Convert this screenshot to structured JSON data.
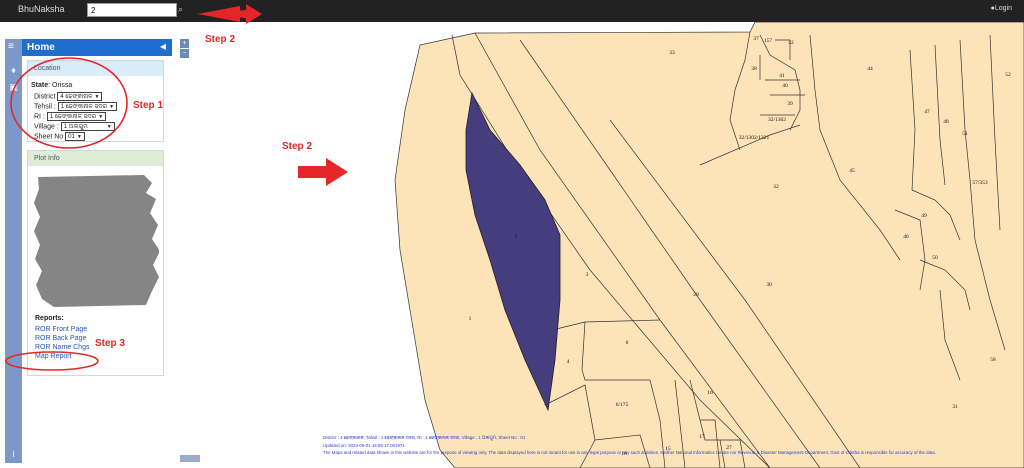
{
  "header": {
    "brand": "BhuNaksha",
    "search_value": "2",
    "login": "Login"
  },
  "sidebar": {
    "home_title": "Home",
    "location": {
      "header": "Location",
      "state_label": "State",
      "state_value": "Orissa",
      "fields": [
        {
          "label": "District",
          "value": "4 ଢେଙ୍କାନାଳ"
        },
        {
          "label": "Tehsil",
          "value": "1 ଢେଙ୍କାନାଳ ସଦର"
        },
        {
          "label": "RI",
          "value": "1 ଢେଙ୍କାନାଳ ସଦର"
        },
        {
          "label": "Village",
          "value": "1 ଅଲଗୁମ"
        },
        {
          "label": "Sheet No",
          "value": "01"
        }
      ]
    },
    "plot_info": {
      "header": "Plot Info"
    },
    "reports": {
      "label": "Reports:",
      "links": [
        "ROR Front Page",
        "ROR Back Page",
        "ROR Name Chgs",
        "Map Report"
      ]
    }
  },
  "map": {
    "plots": [
      "33",
      "37",
      "157",
      "42",
      "44",
      "52",
      "38",
      "41",
      "40",
      "39",
      "47",
      "48",
      "51",
      "32/1302",
      "32/1302/1321",
      "45",
      "57/353",
      "32",
      "49",
      "46",
      "50",
      "2",
      "3",
      "29",
      "30",
      "1",
      "6",
      "4",
      "58",
      "16",
      "6/175",
      "31",
      "17",
      "27",
      "15",
      "18"
    ],
    "info_line1": "District : 4 ଢେଙ୍କାନାଳ, Tahsil : 1 ଢେଙ୍କାନାଳ ସଦର, RI : 1 ଢେଙ୍କାନାଳ ସଦର, Village : 1 ଅଲଗୁମ, Sheet No : 01",
    "info_line2": "Updated on: 2023-09-01 15:05:17.001971",
    "info_line3": "The Maps and related data shown in this website are for the purpose of viewing only. The data displayed here is not meant for use in any legal purpose or any such activities. Neither National Informatics Centre nor Revenue & Disaster Management Department, Govt of Odisha is responsible for accuracy of the data."
  },
  "annotations": {
    "step1": "Step 1",
    "step2_top": "Step 2",
    "step2_map": "Step 2",
    "step3": "Step 3"
  },
  "colors": {
    "topbar": "#222222",
    "home_header": "#1f6dcc",
    "rail": "#7d98c8",
    "parcel": "#fde3b8",
    "selected_parcel": "#453d7e",
    "annotation_red": "#e42628",
    "link": "#2255bb"
  }
}
